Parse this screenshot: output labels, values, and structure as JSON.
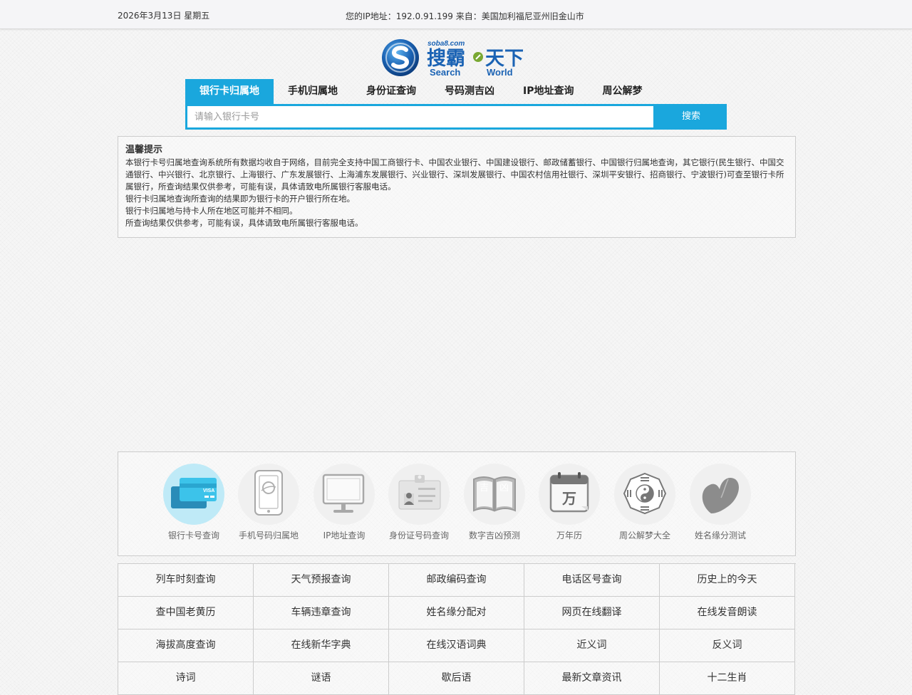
{
  "topbar": {
    "date": "2026年3月13日 星期五",
    "ip_info": "您的IP地址：192.0.91.199 来自：美国加利福尼亚州旧金山市"
  },
  "logo": {
    "domain": "soba8.com",
    "cn_left": "搜霸",
    "cn_right": "天下",
    "en_left": "Search",
    "en_right": "World",
    "colors": {
      "blue": "#1b63b4",
      "green": "#79a832"
    }
  },
  "tabs": [
    {
      "label": "银行卡归属地",
      "active": true
    },
    {
      "label": "手机归属地",
      "active": false
    },
    {
      "label": "身份证查询",
      "active": false
    },
    {
      "label": "号码测吉凶",
      "active": false
    },
    {
      "label": "IP地址查询",
      "active": false
    },
    {
      "label": "周公解梦",
      "active": false
    }
  ],
  "search": {
    "placeholder": "请输入银行卡号",
    "value": "",
    "button": "搜索",
    "accent": "#1aa7dd"
  },
  "notice": {
    "title": "温馨提示",
    "lines": [
      "本银行卡号归属地查询系统所有数据均收自于网络，目前完全支持中国工商银行卡、中国农业银行、中国建设银行、邮政储蓄银行、中国银行归属地查询，其它银行(民生银行、中国交通银行、中兴银行、北京银行、上海银行、广东发展银行、上海浦东发展银行、兴业银行、深圳发展银行、中国农村信用社银行、深圳平安银行、招商银行、宁波银行)可查至银行卡所属银行，所查询结果仅供参考，可能有误，具体请致电所属银行客服电话。",
      "银行卡归属地查询所查询的结果即为银行卡的开户银行所在地。",
      "银行卡归属地与持卡人所在地区可能并不相同。",
      "所查询结果仅供参考，可能有误，具体请致电所属银行客服电话。"
    ]
  },
  "tools": [
    {
      "label": "银行卡号查询",
      "icon": "bank-card-icon",
      "card_text": "VISA"
    },
    {
      "label": "手机号码归属地",
      "icon": "mobile-phone-icon"
    },
    {
      "label": "IP地址查询",
      "icon": "monitor-icon"
    },
    {
      "label": "身份证号码查询",
      "icon": "id-card-icon"
    },
    {
      "label": "数字吉凶预测",
      "icon": "fortune-book-icon",
      "book_left": "吉",
      "book_right": "凶"
    },
    {
      "label": "万年历",
      "icon": "calendar-icon",
      "calendar_char": "万"
    },
    {
      "label": "周公解梦大全",
      "icon": "bagua-icon"
    },
    {
      "label": "姓名缘分测试",
      "icon": "heart-icon"
    }
  ],
  "links": [
    "列车时刻查询",
    "天气预报查询",
    "邮政编码查询",
    "电话区号查询",
    "历史上的今天",
    "查中国老黄历",
    "车辆违章查询",
    "姓名缘分配对",
    "网页在线翻译",
    "在线发音朗读",
    "海拔高度查询",
    "在线新华字典",
    "在线汉语词典",
    "近义词",
    "反义词",
    "诗词",
    "谜语",
    "歇后语",
    "最新文章资讯",
    "十二生肖"
  ]
}
